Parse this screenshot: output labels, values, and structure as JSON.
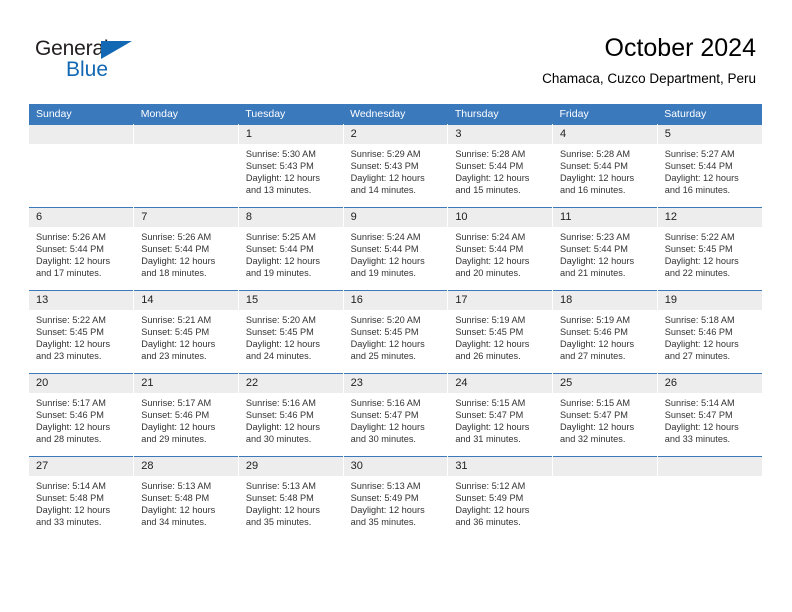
{
  "brand": {
    "name_top": "General",
    "name_bottom": "Blue",
    "accent_color": "#1268b3"
  },
  "header": {
    "title": "October 2024",
    "subtitle": "Chamaca, Cuzco Department, Peru"
  },
  "theme": {
    "header_band": "#3b79bd",
    "daynum_band": "#ededed",
    "text": "#333333"
  },
  "weekday_headers": [
    "Sunday",
    "Monday",
    "Tuesday",
    "Wednesday",
    "Thursday",
    "Friday",
    "Saturday"
  ],
  "weeks": [
    [
      {
        "day": "",
        "blank": true
      },
      {
        "day": "",
        "blank": true
      },
      {
        "day": "1",
        "sunrise": "Sunrise: 5:30 AM",
        "sunset": "Sunset: 5:43 PM",
        "daylight1": "Daylight: 12 hours",
        "daylight2": "and 13 minutes."
      },
      {
        "day": "2",
        "sunrise": "Sunrise: 5:29 AM",
        "sunset": "Sunset: 5:43 PM",
        "daylight1": "Daylight: 12 hours",
        "daylight2": "and 14 minutes."
      },
      {
        "day": "3",
        "sunrise": "Sunrise: 5:28 AM",
        "sunset": "Sunset: 5:44 PM",
        "daylight1": "Daylight: 12 hours",
        "daylight2": "and 15 minutes."
      },
      {
        "day": "4",
        "sunrise": "Sunrise: 5:28 AM",
        "sunset": "Sunset: 5:44 PM",
        "daylight1": "Daylight: 12 hours",
        "daylight2": "and 16 minutes."
      },
      {
        "day": "5",
        "sunrise": "Sunrise: 5:27 AM",
        "sunset": "Sunset: 5:44 PM",
        "daylight1": "Daylight: 12 hours",
        "daylight2": "and 16 minutes."
      }
    ],
    [
      {
        "day": "6",
        "sunrise": "Sunrise: 5:26 AM",
        "sunset": "Sunset: 5:44 PM",
        "daylight1": "Daylight: 12 hours",
        "daylight2": "and 17 minutes."
      },
      {
        "day": "7",
        "sunrise": "Sunrise: 5:26 AM",
        "sunset": "Sunset: 5:44 PM",
        "daylight1": "Daylight: 12 hours",
        "daylight2": "and 18 minutes."
      },
      {
        "day": "8",
        "sunrise": "Sunrise: 5:25 AM",
        "sunset": "Sunset: 5:44 PM",
        "daylight1": "Daylight: 12 hours",
        "daylight2": "and 19 minutes."
      },
      {
        "day": "9",
        "sunrise": "Sunrise: 5:24 AM",
        "sunset": "Sunset: 5:44 PM",
        "daylight1": "Daylight: 12 hours",
        "daylight2": "and 19 minutes."
      },
      {
        "day": "10",
        "sunrise": "Sunrise: 5:24 AM",
        "sunset": "Sunset: 5:44 PM",
        "daylight1": "Daylight: 12 hours",
        "daylight2": "and 20 minutes."
      },
      {
        "day": "11",
        "sunrise": "Sunrise: 5:23 AM",
        "sunset": "Sunset: 5:44 PM",
        "daylight1": "Daylight: 12 hours",
        "daylight2": "and 21 minutes."
      },
      {
        "day": "12",
        "sunrise": "Sunrise: 5:22 AM",
        "sunset": "Sunset: 5:45 PM",
        "daylight1": "Daylight: 12 hours",
        "daylight2": "and 22 minutes."
      }
    ],
    [
      {
        "day": "13",
        "sunrise": "Sunrise: 5:22 AM",
        "sunset": "Sunset: 5:45 PM",
        "daylight1": "Daylight: 12 hours",
        "daylight2": "and 23 minutes."
      },
      {
        "day": "14",
        "sunrise": "Sunrise: 5:21 AM",
        "sunset": "Sunset: 5:45 PM",
        "daylight1": "Daylight: 12 hours",
        "daylight2": "and 23 minutes."
      },
      {
        "day": "15",
        "sunrise": "Sunrise: 5:20 AM",
        "sunset": "Sunset: 5:45 PM",
        "daylight1": "Daylight: 12 hours",
        "daylight2": "and 24 minutes."
      },
      {
        "day": "16",
        "sunrise": "Sunrise: 5:20 AM",
        "sunset": "Sunset: 5:45 PM",
        "daylight1": "Daylight: 12 hours",
        "daylight2": "and 25 minutes."
      },
      {
        "day": "17",
        "sunrise": "Sunrise: 5:19 AM",
        "sunset": "Sunset: 5:45 PM",
        "daylight1": "Daylight: 12 hours",
        "daylight2": "and 26 minutes."
      },
      {
        "day": "18",
        "sunrise": "Sunrise: 5:19 AM",
        "sunset": "Sunset: 5:46 PM",
        "daylight1": "Daylight: 12 hours",
        "daylight2": "and 27 minutes."
      },
      {
        "day": "19",
        "sunrise": "Sunrise: 5:18 AM",
        "sunset": "Sunset: 5:46 PM",
        "daylight1": "Daylight: 12 hours",
        "daylight2": "and 27 minutes."
      }
    ],
    [
      {
        "day": "20",
        "sunrise": "Sunrise: 5:17 AM",
        "sunset": "Sunset: 5:46 PM",
        "daylight1": "Daylight: 12 hours",
        "daylight2": "and 28 minutes."
      },
      {
        "day": "21",
        "sunrise": "Sunrise: 5:17 AM",
        "sunset": "Sunset: 5:46 PM",
        "daylight1": "Daylight: 12 hours",
        "daylight2": "and 29 minutes."
      },
      {
        "day": "22",
        "sunrise": "Sunrise: 5:16 AM",
        "sunset": "Sunset: 5:46 PM",
        "daylight1": "Daylight: 12 hours",
        "daylight2": "and 30 minutes."
      },
      {
        "day": "23",
        "sunrise": "Sunrise: 5:16 AM",
        "sunset": "Sunset: 5:47 PM",
        "daylight1": "Daylight: 12 hours",
        "daylight2": "and 30 minutes."
      },
      {
        "day": "24",
        "sunrise": "Sunrise: 5:15 AM",
        "sunset": "Sunset: 5:47 PM",
        "daylight1": "Daylight: 12 hours",
        "daylight2": "and 31 minutes."
      },
      {
        "day": "25",
        "sunrise": "Sunrise: 5:15 AM",
        "sunset": "Sunset: 5:47 PM",
        "daylight1": "Daylight: 12 hours",
        "daylight2": "and 32 minutes."
      },
      {
        "day": "26",
        "sunrise": "Sunrise: 5:14 AM",
        "sunset": "Sunset: 5:47 PM",
        "daylight1": "Daylight: 12 hours",
        "daylight2": "and 33 minutes."
      }
    ],
    [
      {
        "day": "27",
        "sunrise": "Sunrise: 5:14 AM",
        "sunset": "Sunset: 5:48 PM",
        "daylight1": "Daylight: 12 hours",
        "daylight2": "and 33 minutes."
      },
      {
        "day": "28",
        "sunrise": "Sunrise: 5:13 AM",
        "sunset": "Sunset: 5:48 PM",
        "daylight1": "Daylight: 12 hours",
        "daylight2": "and 34 minutes."
      },
      {
        "day": "29",
        "sunrise": "Sunrise: 5:13 AM",
        "sunset": "Sunset: 5:48 PM",
        "daylight1": "Daylight: 12 hours",
        "daylight2": "and 35 minutes."
      },
      {
        "day": "30",
        "sunrise": "Sunrise: 5:13 AM",
        "sunset": "Sunset: 5:49 PM",
        "daylight1": "Daylight: 12 hours",
        "daylight2": "and 35 minutes."
      },
      {
        "day": "31",
        "sunrise": "Sunrise: 5:12 AM",
        "sunset": "Sunset: 5:49 PM",
        "daylight1": "Daylight: 12 hours",
        "daylight2": "and 36 minutes."
      },
      {
        "day": "",
        "blank": true
      },
      {
        "day": "",
        "blank": true
      }
    ]
  ]
}
